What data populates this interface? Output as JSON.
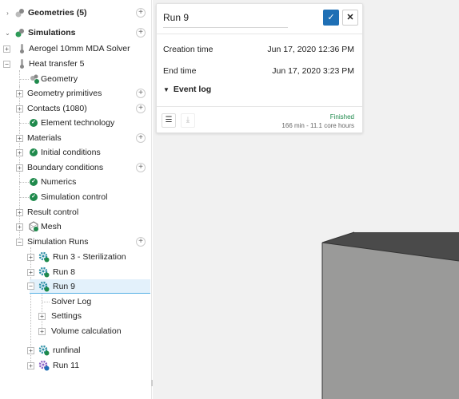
{
  "tree": {
    "rows": [
      {
        "label": "Geometries (5)",
        "bold": true
      },
      {
        "label": "Simulations",
        "bold": true
      },
      {
        "label": "Aerogel 10mm MDA Solver"
      },
      {
        "label": "Heat transfer 5"
      },
      {
        "label": "Geometry"
      },
      {
        "label": "Geometry primitives"
      },
      {
        "label": "Contacts (1080)"
      },
      {
        "label": "Element technology"
      },
      {
        "label": "Materials"
      },
      {
        "label": "Initial conditions"
      },
      {
        "label": "Boundary conditions"
      },
      {
        "label": "Numerics"
      },
      {
        "label": "Simulation control"
      },
      {
        "label": "Result control"
      },
      {
        "label": "Mesh"
      },
      {
        "label": "Simulation Runs"
      },
      {
        "label": "Run 3 - Sterilization"
      },
      {
        "label": "Run 8"
      },
      {
        "label": "Run 9",
        "selected": true
      },
      {
        "label": "Solver Log"
      },
      {
        "label": "Settings"
      },
      {
        "label": "Volume calculation"
      },
      {
        "label": "runfinal"
      },
      {
        "label": "Run 11"
      }
    ]
  },
  "card": {
    "title": "Run 9",
    "confirm_icon": "check-icon",
    "cancel_icon": "close-icon",
    "fields": [
      {
        "label": "Creation time",
        "value": "Jun 17, 2020 12:36 PM"
      },
      {
        "label": "End time",
        "value": "Jun 17, 2020 3:23 PM"
      }
    ],
    "event_log_label": "Event log",
    "status": "Finished",
    "stats": "166 min - 11.1 core hours"
  },
  "colors": {
    "accent": "#1e6fb5",
    "success": "#1f8a4c",
    "selection_bg": "#e3f1fb",
    "box_top": "#4a4a4a",
    "box_front": "#9a9a99"
  }
}
